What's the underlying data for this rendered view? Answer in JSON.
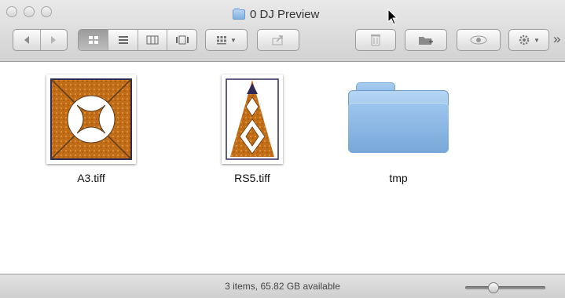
{
  "window": {
    "title": "0 DJ Preview"
  },
  "toolbar": {
    "back_icon": "back-arrow-icon",
    "forward_icon": "forward-arrow-icon",
    "view_modes": [
      "icon-view-icon",
      "list-view-icon",
      "column-view-icon",
      "coverflow-view-icon"
    ],
    "selected_view": "icon",
    "arrange_icon": "arrange-grid-icon",
    "share_icon": "share-icon",
    "trash_icon": "trash-icon",
    "new_folder_icon": "new-folder-icon",
    "quicklook_icon": "eye-icon",
    "action_icon": "gear-icon",
    "overflow": "»"
  },
  "files": [
    {
      "name": "A3.tiff",
      "kind": "image"
    },
    {
      "name": "RS5.tiff",
      "kind": "image"
    },
    {
      "name": "tmp",
      "kind": "folder"
    }
  ],
  "status": {
    "text": "3 items, 65.82 GB available",
    "icon_size_level": 0.35
  },
  "colors": {
    "quilt_orange": "#c7711a",
    "quilt_dark": "#3b2a1a",
    "folder_blue": "#8bbae6"
  }
}
